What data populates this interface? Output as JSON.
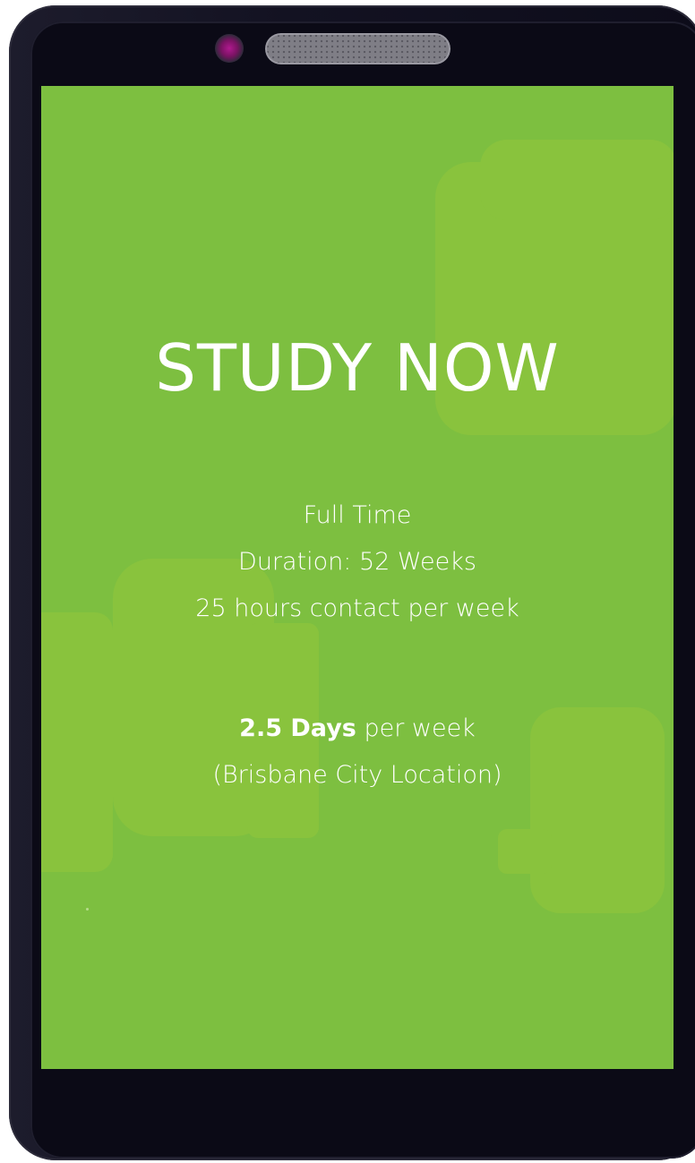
{
  "screen": {
    "title": "STUDY NOW",
    "details": {
      "line1": "Full Time",
      "line2": "Duration: 52 Weeks",
      "line3": "25 hours contact per week"
    },
    "schedule": {
      "days_bold": "2.5 Days",
      "days_rest": " per week",
      "location": "(Brisbane City Location)"
    }
  },
  "colors": {
    "screen_background": "#7dbf40",
    "phone_body": "#131222",
    "text": "#ffffff"
  }
}
